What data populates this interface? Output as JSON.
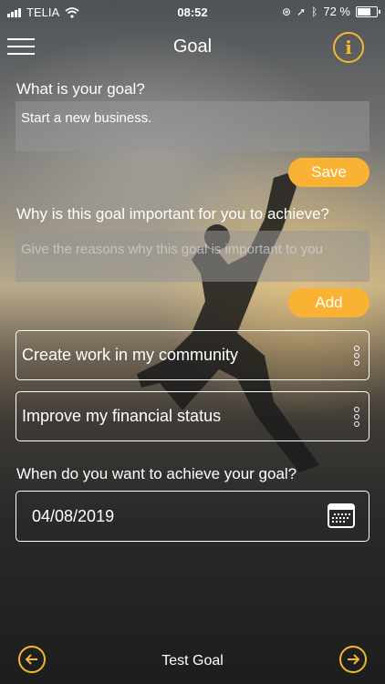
{
  "status_bar": {
    "carrier": "TELIA",
    "time": "08:52",
    "battery": "72 %"
  },
  "header": {
    "title": "Goal"
  },
  "goal_section": {
    "label": "What is your goal?",
    "value": "Start a new business.",
    "save_label": "Save"
  },
  "reason_section": {
    "label": "Why is this goal important for you to achieve?",
    "placeholder": "Give the reasons why this goal is important to you",
    "add_label": "Add",
    "items": [
      {
        "label": "Create work in my community"
      },
      {
        "label": "Improve my financial status"
      }
    ]
  },
  "date_section": {
    "label": "When do you want to achieve your goal?",
    "value": "04/08/2019"
  },
  "footer": {
    "title": "Test Goal"
  },
  "colors": {
    "accent": "#f9b233"
  },
  "icons": [
    "menu-icon",
    "info-icon",
    "more-vertical-icon",
    "calendar-icon",
    "arrow-left-icon",
    "arrow-right-icon"
  ]
}
